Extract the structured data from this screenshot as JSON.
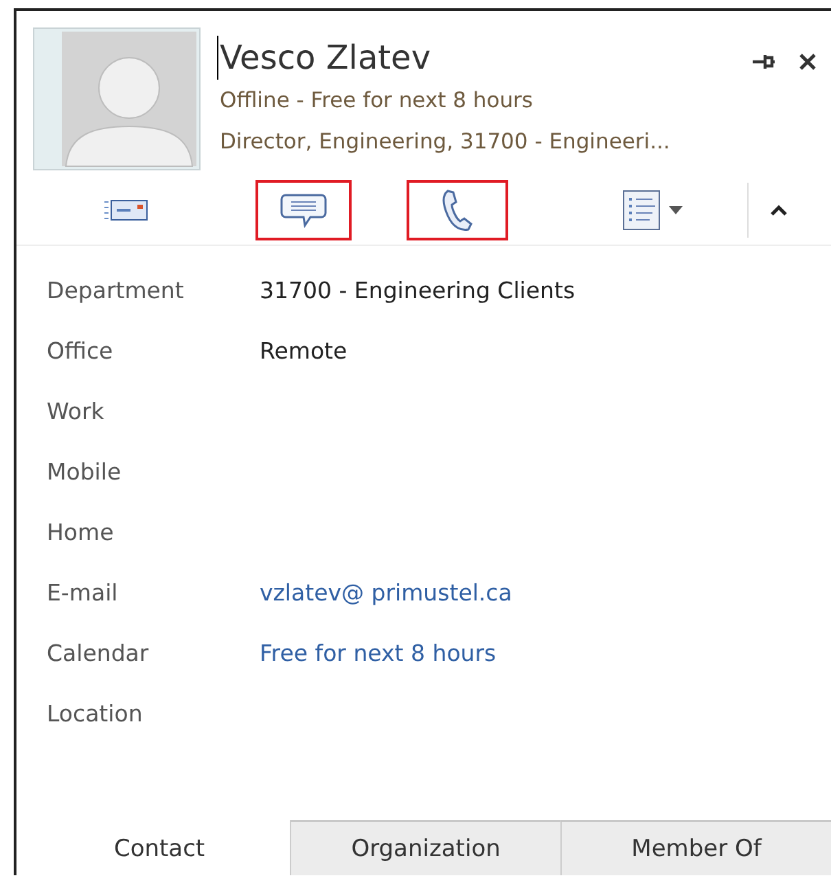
{
  "contact": {
    "name": "Vesco Zlatev",
    "status": "Offline - Free for next 8 hours",
    "title": "Director, Engineering, 31700 - Engineeri..."
  },
  "toolbar": [
    {
      "kind": "email",
      "highlighted": false
    },
    {
      "kind": "chat",
      "highlighted": true
    },
    {
      "kind": "call",
      "highlighted": true
    },
    {
      "kind": "menu",
      "highlighted": false
    }
  ],
  "fields": [
    {
      "label": "Department",
      "value": "31700 - Engineering Clients",
      "kind": "text"
    },
    {
      "label": "Office",
      "value": "Remote",
      "kind": "text"
    },
    {
      "label": "Work"
    },
    {
      "label": "Mobile"
    },
    {
      "label": "Home"
    },
    {
      "label": "E-mail",
      "value": "vzlatev@ primustel.ca",
      "kind": "link"
    },
    {
      "label": "Calendar",
      "value": "Free for next 8 hours",
      "kind": "link"
    },
    {
      "label": "Location"
    }
  ],
  "tabs": [
    {
      "label": "Contact",
      "selected": true
    },
    {
      "label": "Organization",
      "selected": false
    },
    {
      "label": "Member Of",
      "selected": false
    }
  ]
}
